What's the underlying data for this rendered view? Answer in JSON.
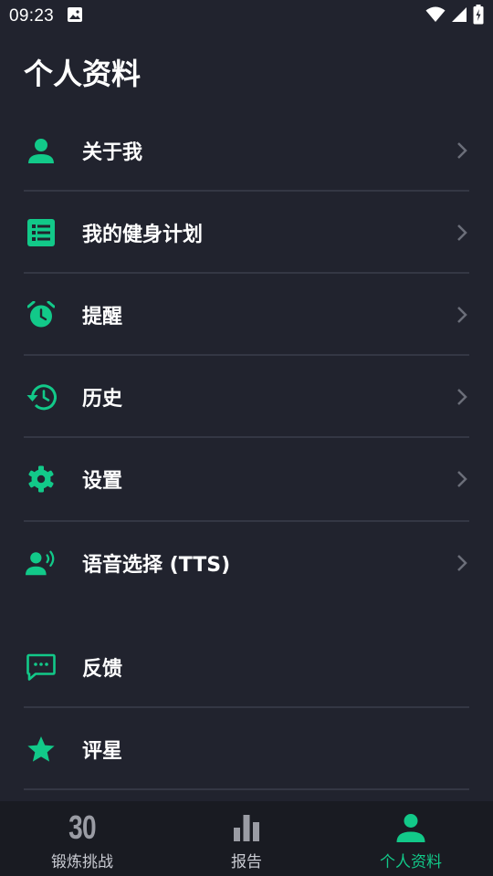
{
  "status_bar": {
    "time": "09:23"
  },
  "header": {
    "title": "个人资料"
  },
  "menu": {
    "items": [
      {
        "label": "关于我",
        "icon": "person-icon"
      },
      {
        "label": "我的健身计划",
        "icon": "list-icon"
      },
      {
        "label": "提醒",
        "icon": "alarm-icon"
      },
      {
        "label": "历史",
        "icon": "history-icon"
      },
      {
        "label": "设置",
        "icon": "gear-icon"
      },
      {
        "label": "语音选择 (TTS)",
        "icon": "voice-icon"
      },
      {
        "label": "反馈",
        "icon": "feedback-icon"
      },
      {
        "label": "评星",
        "icon": "star-icon"
      }
    ]
  },
  "bottom_nav": {
    "items": [
      {
        "label": "锻炼挑战",
        "icon_text": "30",
        "active": false
      },
      {
        "label": "报告",
        "icon": "bar-chart-icon",
        "active": false
      },
      {
        "label": "个人资料",
        "icon": "person-icon",
        "active": true
      }
    ]
  },
  "colors": {
    "background": "#21232e",
    "accent": "#12c989",
    "divider": "#343744",
    "nav_background": "#191b22"
  }
}
